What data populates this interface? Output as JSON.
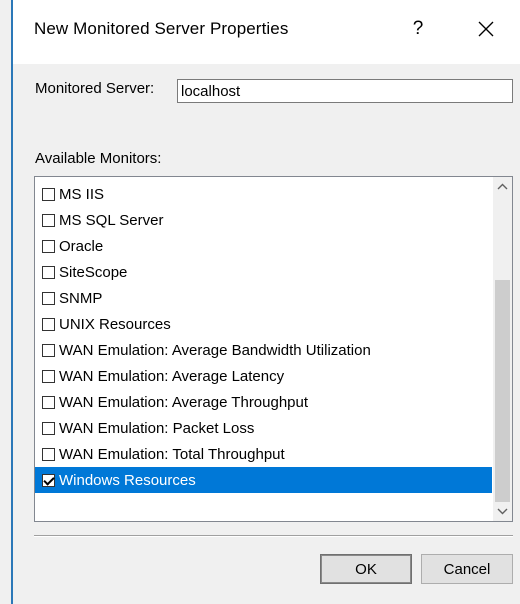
{
  "dialog": {
    "title": "New Monitored Server Properties",
    "help_label": "?",
    "close_icon": "close-icon"
  },
  "server": {
    "label": "Monitored Server:",
    "value": "localhost"
  },
  "monitors": {
    "label": "Available Monitors:",
    "items": [
      {
        "label": "MS IIS",
        "checked": false,
        "selected": false
      },
      {
        "label": "MS SQL Server",
        "checked": false,
        "selected": false
      },
      {
        "label": "Oracle",
        "checked": false,
        "selected": false
      },
      {
        "label": "SiteScope",
        "checked": false,
        "selected": false
      },
      {
        "label": "SNMP",
        "checked": false,
        "selected": false
      },
      {
        "label": "UNIX Resources",
        "checked": false,
        "selected": false
      },
      {
        "label": "WAN Emulation: Average Bandwidth Utilization",
        "checked": false,
        "selected": false
      },
      {
        "label": "WAN Emulation: Average Latency",
        "checked": false,
        "selected": false
      },
      {
        "label": "WAN Emulation: Average Throughput",
        "checked": false,
        "selected": false
      },
      {
        "label": "WAN Emulation: Packet Loss",
        "checked": false,
        "selected": false
      },
      {
        "label": "WAN Emulation: Total Throughput",
        "checked": false,
        "selected": false
      },
      {
        "label": "Windows Resources",
        "checked": true,
        "selected": true
      }
    ],
    "scroll_position": "bottom"
  },
  "buttons": {
    "ok": "OK",
    "cancel": "Cancel"
  },
  "colors": {
    "selection": "#0078d7",
    "window_border": "#2b78b8"
  }
}
